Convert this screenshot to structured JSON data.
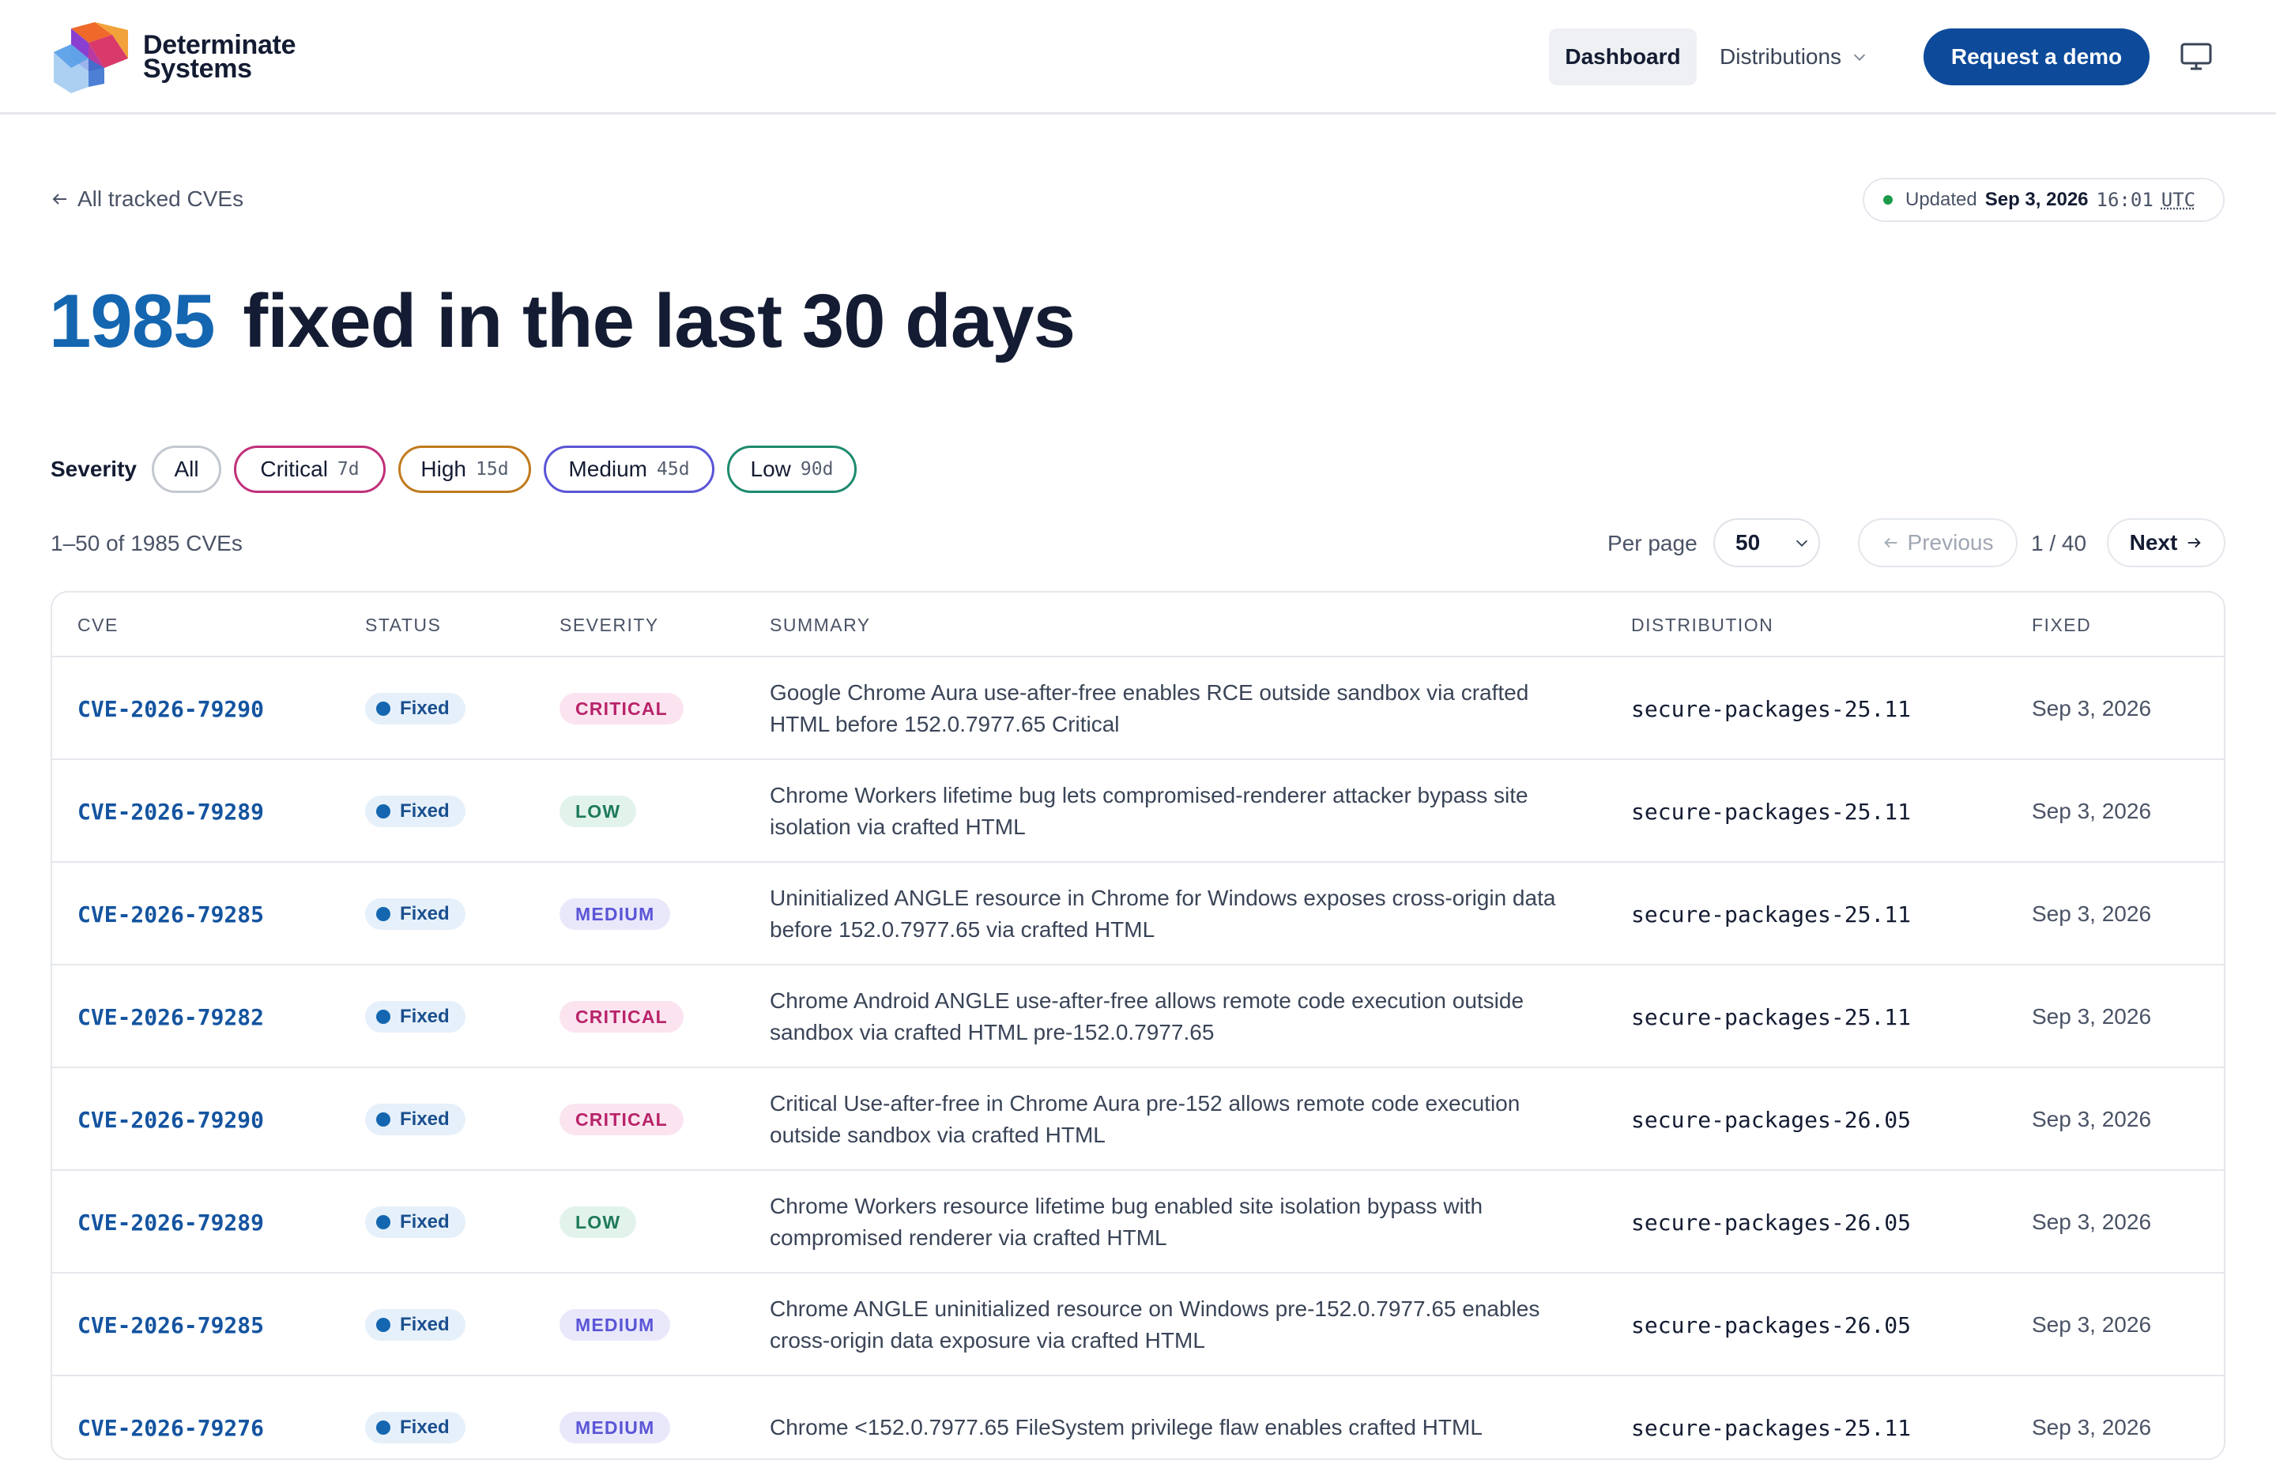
{
  "header": {
    "brand_line1": "Determinate",
    "brand_line2": "Systems",
    "nav_dashboard": "Dashboard",
    "nav_distributions": "Distributions",
    "cta": "Request a demo"
  },
  "back_link": "All tracked CVEs",
  "updated": {
    "label": "Updated",
    "date": "Sep 3, 2026",
    "time": "16:01",
    "tz": "UTC"
  },
  "headline": {
    "count": "1985",
    "text": "fixed in the last 30 days"
  },
  "severity_filter": {
    "label": "Severity",
    "chips": [
      {
        "label": "All",
        "days": "",
        "border": "#c4c8d0"
      },
      {
        "label": "Critical",
        "days": "7d",
        "border": "#c0307a"
      },
      {
        "label": "High",
        "days": "15d",
        "border": "#c07a1e"
      },
      {
        "label": "Medium",
        "days": "45d",
        "border": "#5a55d6"
      },
      {
        "label": "Low",
        "days": "90d",
        "border": "#1e8a6e"
      }
    ]
  },
  "pagination": {
    "range_text": "1–50 of 1985 CVEs",
    "per_page_label": "Per page",
    "per_page_value": "50",
    "previous": "Previous",
    "page_text": "1 / 40",
    "next": "Next"
  },
  "table": {
    "columns": [
      "CVE",
      "Status",
      "Severity",
      "Summary",
      "Distribution",
      "Fixed"
    ],
    "rows": [
      {
        "cve": "CVE-2026-79290",
        "status": "Fixed",
        "severity": "CRITICAL",
        "summary": "Google Chrome Aura use-after-free enables RCE outside sandbox via crafted HTML before 152.0.7977.65 Critical",
        "distribution": "secure-packages-25.11",
        "fixed": "Sep 3, 2026"
      },
      {
        "cve": "CVE-2026-79289",
        "status": "Fixed",
        "severity": "LOW",
        "summary": "Chrome Workers lifetime bug lets compromised-renderer attacker bypass site isolation via crafted HTML",
        "distribution": "secure-packages-25.11",
        "fixed": "Sep 3, 2026"
      },
      {
        "cve": "CVE-2026-79285",
        "status": "Fixed",
        "severity": "MEDIUM",
        "summary": "Uninitialized ANGLE resource in Chrome for Windows exposes cross-origin data before 152.0.7977.65 via crafted HTML",
        "distribution": "secure-packages-25.11",
        "fixed": "Sep 3, 2026"
      },
      {
        "cve": "CVE-2026-79282",
        "status": "Fixed",
        "severity": "CRITICAL",
        "summary": "Chrome Android ANGLE use-after-free allows remote code execution outside sandbox via crafted HTML pre-152.0.7977.65",
        "distribution": "secure-packages-25.11",
        "fixed": "Sep 3, 2026"
      },
      {
        "cve": "CVE-2026-79290",
        "status": "Fixed",
        "severity": "CRITICAL",
        "summary": "Critical Use-after-free in Chrome Aura pre-152 allows remote code execution outside sandbox via crafted HTML",
        "distribution": "secure-packages-26.05",
        "fixed": "Sep 3, 2026"
      },
      {
        "cve": "CVE-2026-79289",
        "status": "Fixed",
        "severity": "LOW",
        "summary": "Chrome Workers resource lifetime bug enabled site isolation bypass with compromised renderer via crafted HTML",
        "distribution": "secure-packages-26.05",
        "fixed": "Sep 3, 2026"
      },
      {
        "cve": "CVE-2026-79285",
        "status": "Fixed",
        "severity": "MEDIUM",
        "summary": "Chrome ANGLE uninitialized resource on Windows pre-152.0.7977.65 enables cross-origin data exposure via crafted HTML",
        "distribution": "secure-packages-26.05",
        "fixed": "Sep 3, 2026"
      },
      {
        "cve": "CVE-2026-79276",
        "status": "Fixed",
        "severity": "MEDIUM",
        "summary": "Chrome <152.0.7977.65 FileSystem privilege flaw enables crafted HTML",
        "distribution": "secure-packages-25.11",
        "fixed": "Sep 3, 2026"
      }
    ]
  },
  "colors": {
    "accent": "#1466b0",
    "brand_button": "#0d4a9a",
    "critical_bg": "#fbe4ef",
    "critical_fg": "#b8236a",
    "low_bg": "#e2f3ec",
    "low_fg": "#1e7a5a",
    "medium_bg": "#e9e8fb",
    "medium_fg": "#5a55d6"
  }
}
